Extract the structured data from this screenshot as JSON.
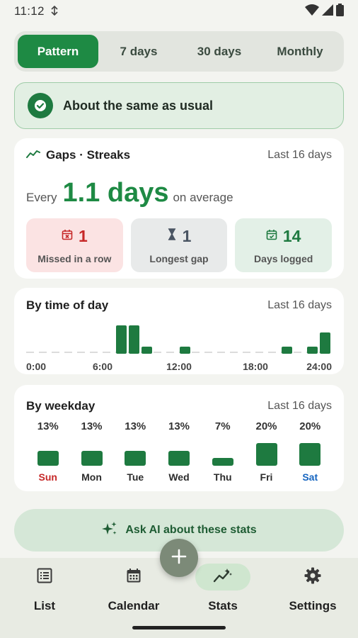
{
  "status_bar": {
    "time": "11:12"
  },
  "tabs": [
    {
      "label": "Pattern",
      "active": true
    },
    {
      "label": "7 days",
      "active": false
    },
    {
      "label": "30 days",
      "active": false
    },
    {
      "label": "Monthly",
      "active": false
    }
  ],
  "banner": {
    "text": "About the same as usual",
    "icon": "check-circle-icon"
  },
  "streaks": {
    "title": "Gaps · Streaks",
    "range": "Last 16 days",
    "avg_prefix": "Every",
    "avg_value": "1.1 days",
    "avg_suffix": "on average",
    "stats": [
      {
        "value": "1",
        "label": "Missed in a row",
        "icon": "calendar-x-icon",
        "color": "#c62828"
      },
      {
        "value": "1",
        "label": "Longest gap",
        "icon": "hourglass-icon",
        "color": "#4a5563"
      },
      {
        "value": "14",
        "label": "Days logged",
        "icon": "calendar-check-icon",
        "color": "#1e7a40"
      }
    ]
  },
  "time_of_day": {
    "title": "By time of day",
    "range": "Last 16 days",
    "tick_labels": [
      "0:00",
      "6:00",
      "12:00",
      "18:00",
      "24:00"
    ]
  },
  "weekday": {
    "title": "By weekday",
    "range": "Last 16 days"
  },
  "chart_data": [
    {
      "type": "bar",
      "title": "By time of day",
      "x": [
        0,
        1,
        2,
        3,
        4,
        5,
        6,
        7,
        8,
        9,
        10,
        11,
        12,
        13,
        14,
        15,
        16,
        17,
        18,
        19,
        20,
        21,
        22,
        23
      ],
      "values": [
        0,
        0,
        0,
        0,
        0,
        0,
        0,
        2,
        2,
        0.5,
        0,
        0,
        0.5,
        0,
        0,
        0,
        0,
        0,
        0,
        0,
        0.5,
        0,
        0.5,
        1.5
      ],
      "xticks": [
        "0:00",
        "6:00",
        "12:00",
        "18:00",
        "24:00"
      ]
    },
    {
      "type": "bar",
      "title": "By weekday",
      "categories": [
        "Sun",
        "Mon",
        "Tue",
        "Wed",
        "Thu",
        "Fri",
        "Sat"
      ],
      "values": [
        13,
        13,
        13,
        13,
        7,
        20,
        20
      ],
      "labels": [
        "13%",
        "13%",
        "13%",
        "13%",
        "7%",
        "20%",
        "20%"
      ],
      "category_colors": [
        "#c62828",
        "#2c2c2c",
        "#2c2c2c",
        "#2c2c2c",
        "#2c2c2c",
        "#2c2c2c",
        "#1565c0"
      ]
    }
  ],
  "ask_ai": {
    "label": "Ask AI about these stats",
    "icon": "sparkle-icon"
  },
  "fab": {
    "icon": "plus-icon"
  },
  "nav": [
    {
      "label": "List",
      "icon": "list-icon",
      "active": false
    },
    {
      "label": "Calendar",
      "icon": "calendar-icon",
      "active": false
    },
    {
      "label": "Stats",
      "icon": "trend-icon",
      "active": true
    },
    {
      "label": "Settings",
      "icon": "gear-icon",
      "active": false
    }
  ],
  "colors": {
    "accent": "#1e8a44",
    "bar": "#1e7a40",
    "background": "#f3f4f0"
  }
}
